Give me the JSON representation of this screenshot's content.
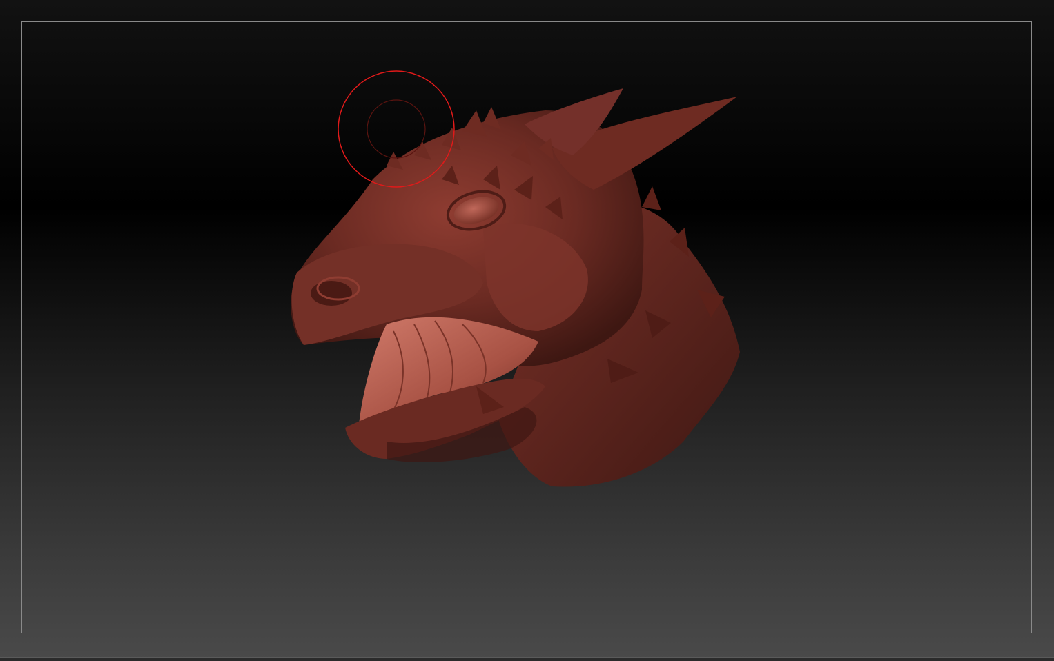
{
  "app": {
    "view": "3d-sculpt-viewport",
    "model_subject": "dragon-head-sculpt",
    "colors": {
      "model": "#6a2a22",
      "model_highlight": "#a65044",
      "mouth_interior": "#b86355",
      "brush_cursor": "#e01a1a",
      "frame_border": "#8a8a8a"
    },
    "brush_cursor": {
      "icon": "circle-brush-cursor"
    }
  }
}
